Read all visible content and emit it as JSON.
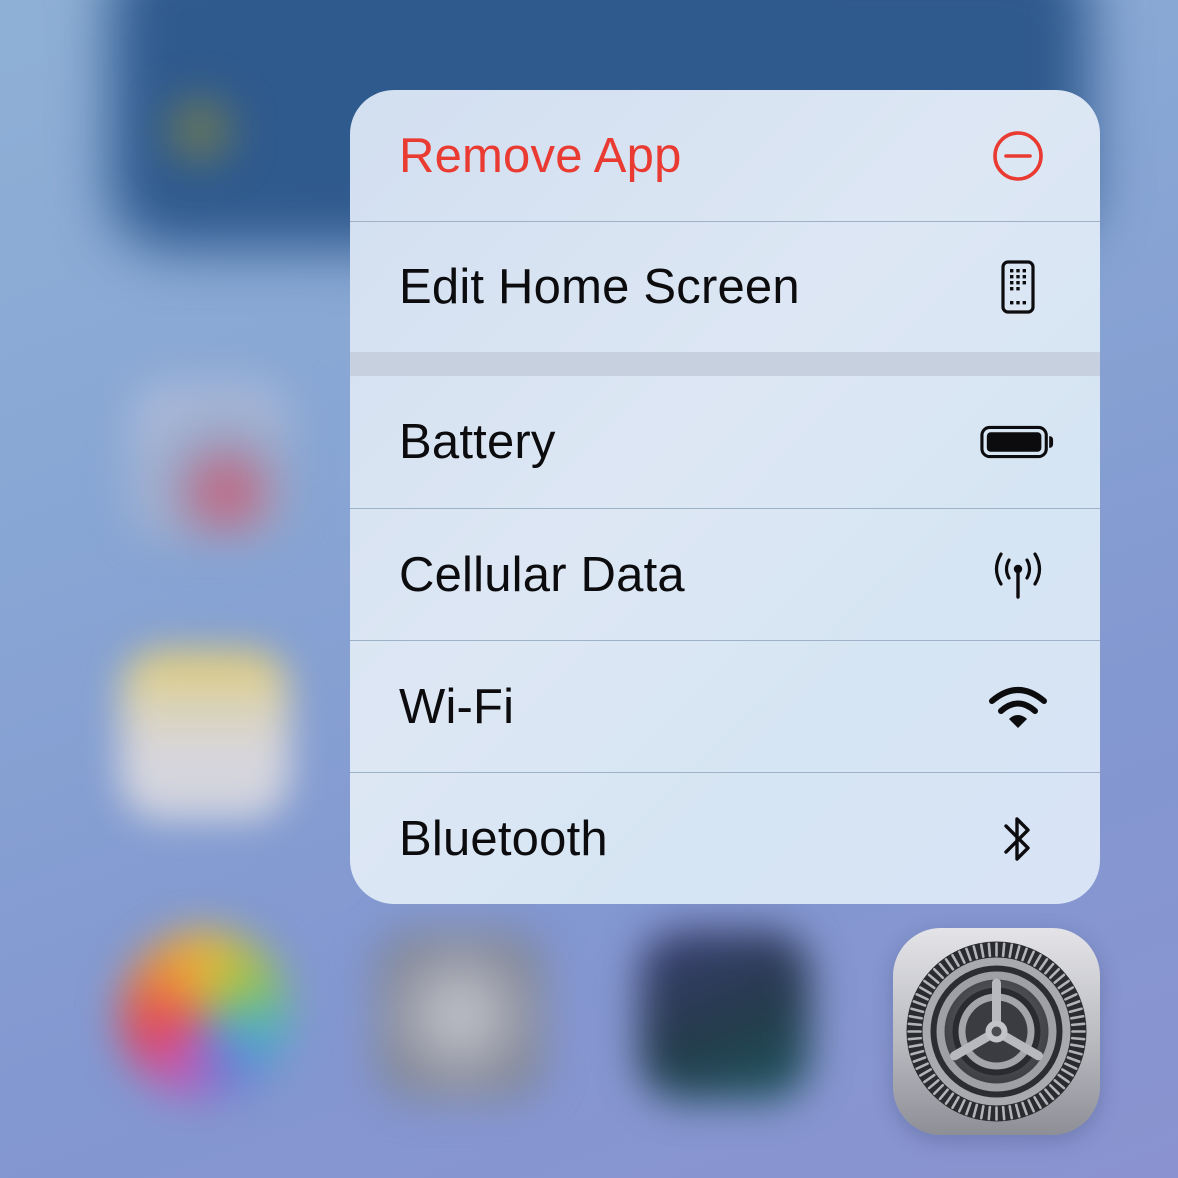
{
  "menu": {
    "groups": [
      {
        "items": [
          {
            "label": "Remove App",
            "icon": "minus-circle-icon",
            "destructive": true
          },
          {
            "label": "Edit Home Screen",
            "icon": "phone-apps-icon",
            "destructive": false
          }
        ]
      },
      {
        "items": [
          {
            "label": "Battery",
            "icon": "battery-icon"
          },
          {
            "label": "Cellular Data",
            "icon": "antenna-icon"
          },
          {
            "label": "Wi-Fi",
            "icon": "wifi-icon"
          },
          {
            "label": "Bluetooth",
            "icon": "bluetooth-icon"
          }
        ]
      }
    ]
  },
  "app": {
    "name": "Settings",
    "icon": "settings-gear-icon"
  },
  "colors": {
    "destructive": "#ea3b32",
    "text": "#0c0c0e",
    "menu_background": "#dde7f4",
    "separator": "#9fb1c9"
  }
}
